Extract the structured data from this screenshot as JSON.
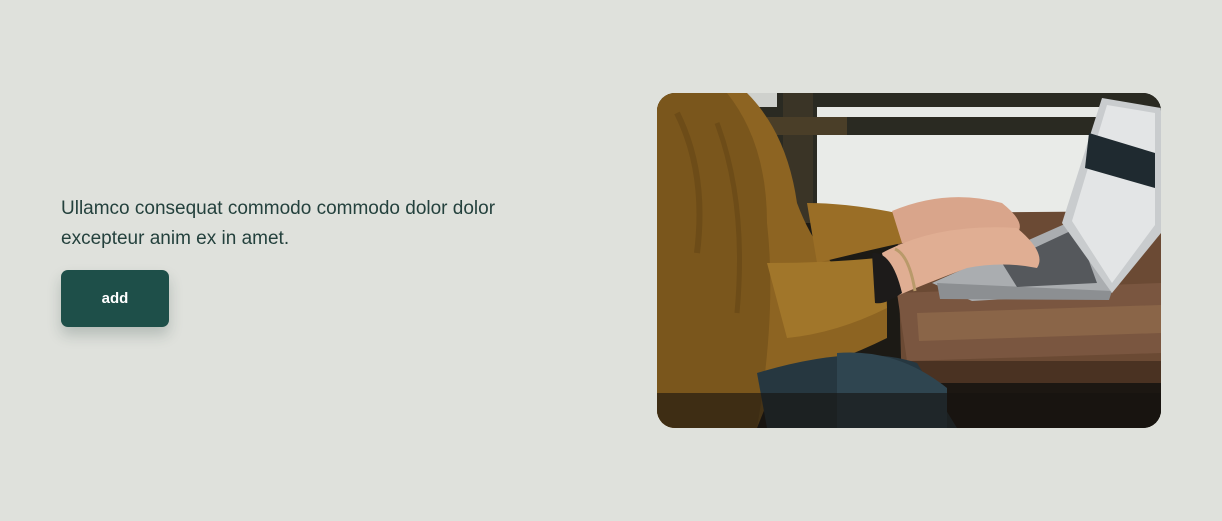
{
  "hero": {
    "description": "Ullamco consequat commodo commodo dolor dolor excepteur anim ex in amet.",
    "button_label": "add"
  },
  "image": {
    "subject": "person-typing-on-laptop",
    "colors": {
      "page_background": "#dfe1dc",
      "text": "#24413d",
      "button": "#1e4f49",
      "button_text": "#ffffff"
    }
  }
}
